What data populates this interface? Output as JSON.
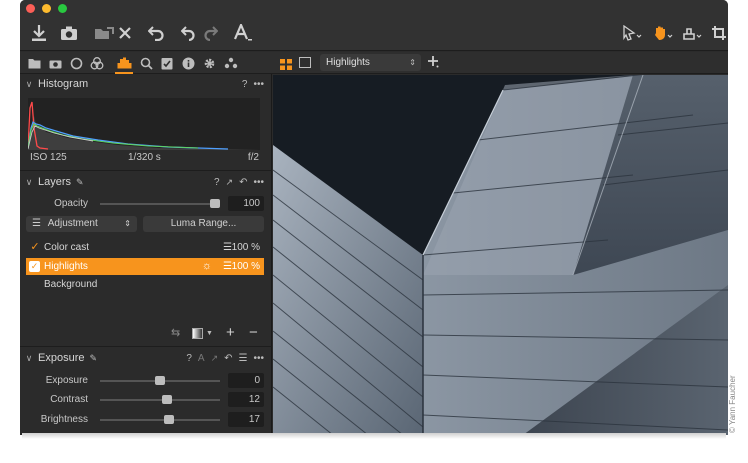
{
  "toolbar": {
    "icons": [
      "import-icon",
      "camera-icon",
      "move-to-icon",
      "delete-icon",
      "undo-all-icon",
      "undo-icon",
      "redo-icon",
      "text-icon",
      "cursor-select-icon",
      "hand-pan-icon",
      "stamp-icon",
      "crop-icon"
    ]
  },
  "tool_tabs": [
    "library-icon",
    "camera-icon",
    "lens-icon",
    "color-icon",
    "exposure-icon",
    "details-icon",
    "adjustments-icon",
    "metadata-icon",
    "settings-icon",
    "styles-icon"
  ],
  "viewer_bar": {
    "layout_icons": [
      "multi-view-icon",
      "single-view-icon"
    ],
    "select_value": "Highlights",
    "add_icon": "plus-icon"
  },
  "histogram": {
    "title": "Histogram",
    "help": "?",
    "more": "•••",
    "iso": "ISO 125",
    "shutter": "1/320 s",
    "aperture": "f/2"
  },
  "layers": {
    "title": "Layers",
    "help": "?",
    "more": "•••",
    "opacity_label": "Opacity",
    "opacity_value": "100",
    "opacity_level": 1.0,
    "adjustment_label": "Adjustment",
    "luma_range_label": "Luma Range...",
    "items": [
      {
        "name": "Color cast",
        "checked": true,
        "opacity": "100 %",
        "selected": false
      },
      {
        "name": "Highlights",
        "checked": true,
        "opacity": "100 %",
        "selected": true
      },
      {
        "name": "Background",
        "checked": false,
        "opacity": "",
        "selected": false
      }
    ],
    "footer_icons": [
      "swap-icon",
      "mask-icon",
      "add-layer-icon",
      "remove-layer-icon"
    ],
    "footer_add": "+",
    "footer_remove": "−"
  },
  "exposure": {
    "title": "Exposure",
    "help": "?",
    "auto": "A",
    "more": "•••",
    "sliders": [
      {
        "label": "Exposure",
        "value": "0",
        "level": 0.5
      },
      {
        "label": "Contrast",
        "value": "12",
        "level": 0.56
      },
      {
        "label": "Brightness",
        "value": "17",
        "level": 0.58
      }
    ]
  },
  "credit": "© Yann Faucher",
  "colors": {
    "accent": "#f7941d",
    "panel": "#2b2b2b",
    "toolbar": "#323232"
  }
}
